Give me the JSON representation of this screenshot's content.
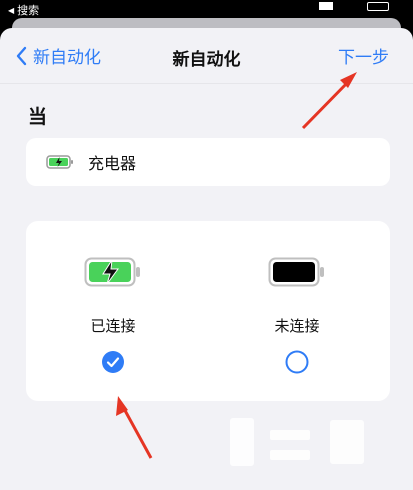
{
  "status_bar": {
    "back_app_label": "搜索"
  },
  "nav": {
    "back_label": "新自动化",
    "title": "新自动化",
    "next_label": "下一步"
  },
  "section": {
    "title": "当"
  },
  "trigger": {
    "icon": "battery-charging-icon",
    "label": "充电器"
  },
  "options": [
    {
      "label": "已连接",
      "icon": "battery-charging-icon",
      "selected": true
    },
    {
      "label": "未连接",
      "icon": "battery-full-icon",
      "selected": false
    }
  ],
  "colors": {
    "accent": "#2f7cf6",
    "battery_green": "#49d25a",
    "annotation_red": "#e53524"
  }
}
